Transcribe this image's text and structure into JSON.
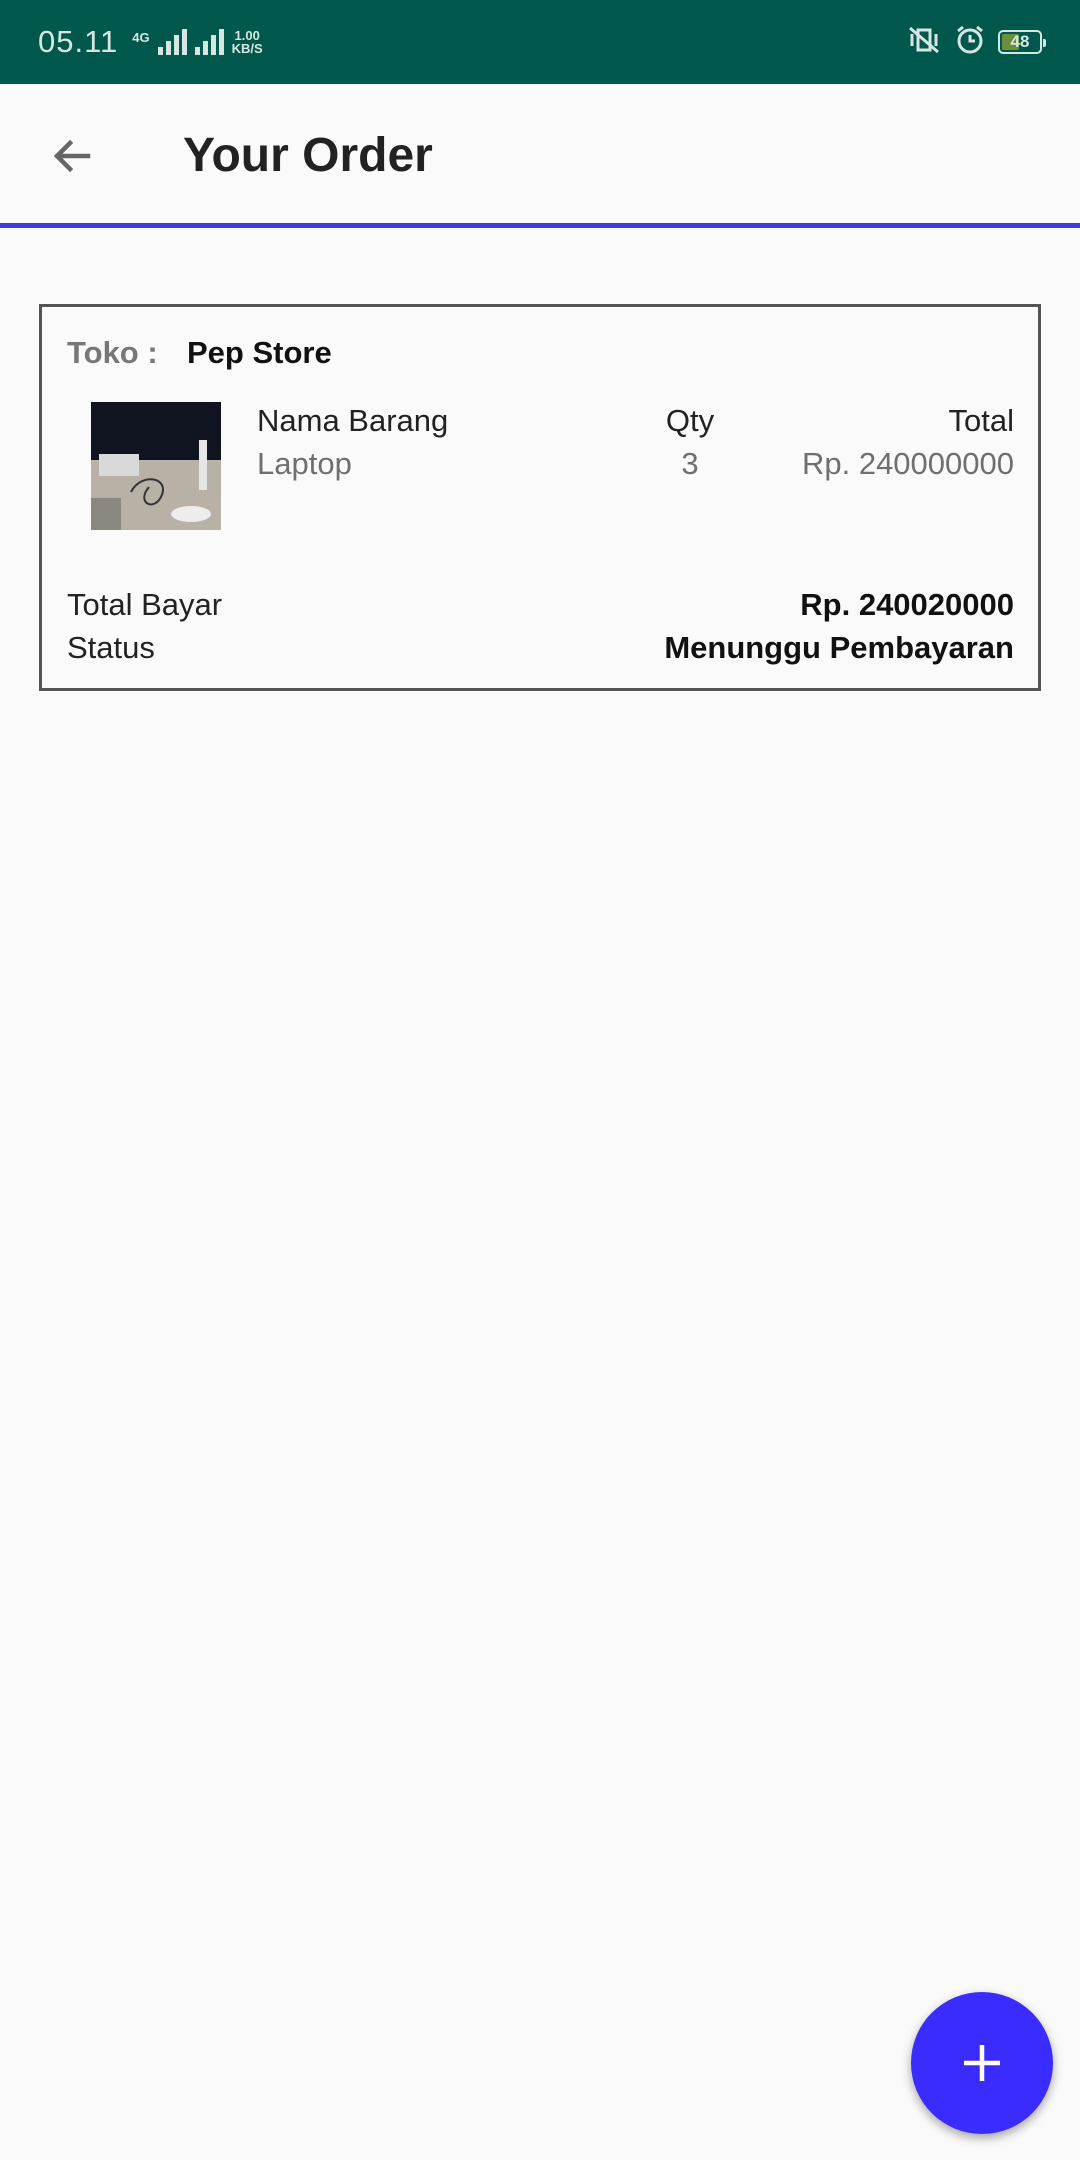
{
  "status_bar": {
    "time": "05.11",
    "network_type": "4G",
    "speed_value": "1.00",
    "speed_unit": "KB/S",
    "battery": "48",
    "battery_level_percent": 48,
    "background_color": "#00574b"
  },
  "app_bar": {
    "title": "Your Order",
    "back_icon": "arrow-back-icon",
    "underline_color": "#3d3ddb"
  },
  "order": {
    "store_label": "Toko :",
    "store_name": "Pep Store",
    "headers": {
      "name": "Nama Barang",
      "qty": "Qty",
      "total": "Total"
    },
    "item": {
      "name": "Laptop",
      "qty": "3",
      "total": "Rp. 240000000",
      "image_icon": "product-photo"
    },
    "summary": {
      "total_bayar_label": "Total Bayar",
      "total_bayar_value": "Rp. 240020000",
      "status_label": "Status",
      "status_value": "Menunggu Pembayaran"
    }
  },
  "fab": {
    "icon": "plus-icon",
    "color": "#3a2cff"
  }
}
